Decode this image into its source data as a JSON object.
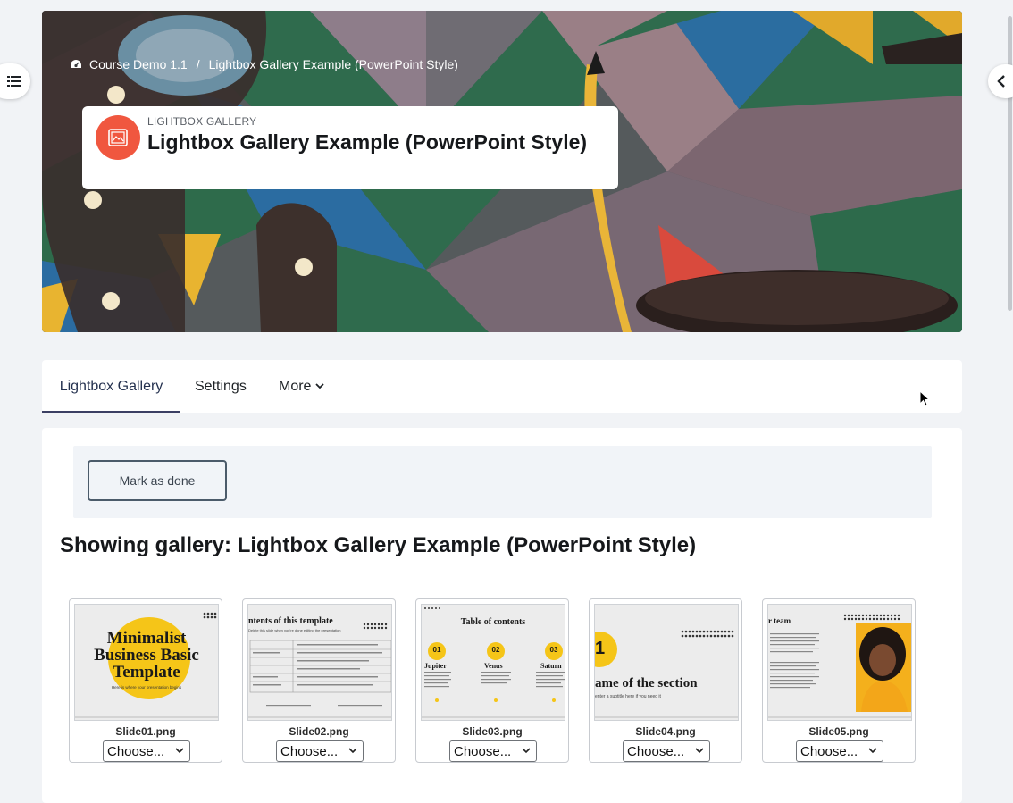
{
  "breadcrumb": {
    "items": [
      "Course Demo 1.1",
      "Lightbox Gallery Example (PowerPoint Style)"
    ],
    "separator": "/"
  },
  "header": {
    "kicker": "LIGHTBOX GALLERY",
    "title": "Lightbox Gallery Example (PowerPoint Style)",
    "icon": "image-icon",
    "icon_color": "#f0573f"
  },
  "tabs": [
    {
      "label": "Lightbox Gallery",
      "active": true
    },
    {
      "label": "Settings",
      "active": false
    },
    {
      "label": "More",
      "active": false
    }
  ],
  "completion": {
    "button_label": "Mark as done"
  },
  "gallery": {
    "heading": "Showing gallery: Lightbox Gallery Example (PowerPoint Style)",
    "items": [
      {
        "filename": "Slide01.png",
        "select_value": "Choose...",
        "slide": {
          "line1": "Minimalist",
          "line2": "Business Basic",
          "line3": "Template",
          "sub": "Here is where your presentation begins"
        }
      },
      {
        "filename": "Slide02.png",
        "select_value": "Choose...",
        "slide": {
          "title": "ntents of this template",
          "sub": "Delete this slide when you're done editing the presentation"
        }
      },
      {
        "filename": "Slide03.png",
        "select_value": "Choose...",
        "slide": {
          "title": "Table of contents",
          "n1": "01",
          "n2": "02",
          "n3": "03",
          "c1": "Jupiter",
          "c2": "Venus",
          "c3": "Saturn"
        }
      },
      {
        "filename": "Slide04.png",
        "select_value": "Choose...",
        "slide": {
          "num": "1",
          "title": "ame of the section",
          "sub": "enter a subtitle here if you need it"
        }
      },
      {
        "filename": "Slide05.png",
        "select_value": "Choose...",
        "slide": {
          "title": "r team"
        }
      }
    ]
  },
  "colors": {
    "accent": "#3b3f63",
    "slide_yellow": "#f5c518",
    "page_bg": "#f1f3f6"
  }
}
